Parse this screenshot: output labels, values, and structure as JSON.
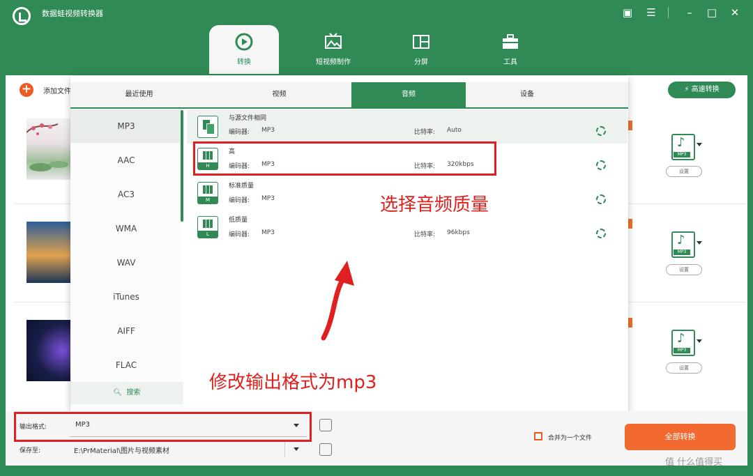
{
  "app": {
    "title": "数据蛙视频转换器"
  },
  "main_tabs": [
    {
      "label": "转换",
      "icon": "convert-icon"
    },
    {
      "label": "短视频制作",
      "icon": "image-icon"
    },
    {
      "label": "分屏",
      "icon": "split-screen-icon"
    },
    {
      "label": "工具",
      "icon": "toolbox-icon"
    }
  ],
  "toolbar": {
    "add_file": "添加文件",
    "fast_convert": "高速转换"
  },
  "popup": {
    "tabs": [
      "最近使用",
      "视频",
      "音频",
      "设备"
    ],
    "active_tab": "音频",
    "formats": [
      "MP3",
      "AAC",
      "AC3",
      "WMA",
      "WAV",
      "iTunes",
      "AIFF",
      "FLAC"
    ],
    "active_format": "MP3",
    "search_label": "搜索",
    "qualities": [
      {
        "name": "与源文件相同",
        "encoder_label": "编码器:",
        "encoder": "MP3",
        "bitrate_label": "比特率:",
        "bitrate": "Auto",
        "badge": ""
      },
      {
        "name": "高",
        "encoder_label": "编码器:",
        "encoder": "MP3",
        "bitrate_label": "比特率:",
        "bitrate": "320kbps",
        "badge": "H"
      },
      {
        "name": "标准质量",
        "encoder_label": "编码器:",
        "encoder": "MP3",
        "bitrate_label": "",
        "bitrate": "",
        "badge": "M"
      },
      {
        "name": "低质量",
        "encoder_label": "编码器:",
        "encoder": "MP3",
        "bitrate_label": "比特率:",
        "bitrate": "96kbps",
        "badge": "L"
      }
    ]
  },
  "file_rows": [
    {
      "format": "MP3",
      "settings": "设置"
    },
    {
      "format": "MP3",
      "settings": "设置"
    },
    {
      "format": "MP3",
      "settings": "设置"
    }
  ],
  "annotations": {
    "select_quality": "选择音频质量",
    "change_format": "修改输出格式为mp3"
  },
  "bottom": {
    "output_format_label": "输出格式:",
    "output_format_value": "MP3",
    "save_to_label": "保存至:",
    "save_to_value": "E:\\PrMaterial\\图片与视频素材",
    "merge_label": "合并为一个文件",
    "convert_all": "全部转换"
  },
  "watermark": "值 什么值得买",
  "colors": {
    "brand_green": "#2f8a56",
    "accent_orange": "#f26a30",
    "annotation_red": "#e02020"
  }
}
